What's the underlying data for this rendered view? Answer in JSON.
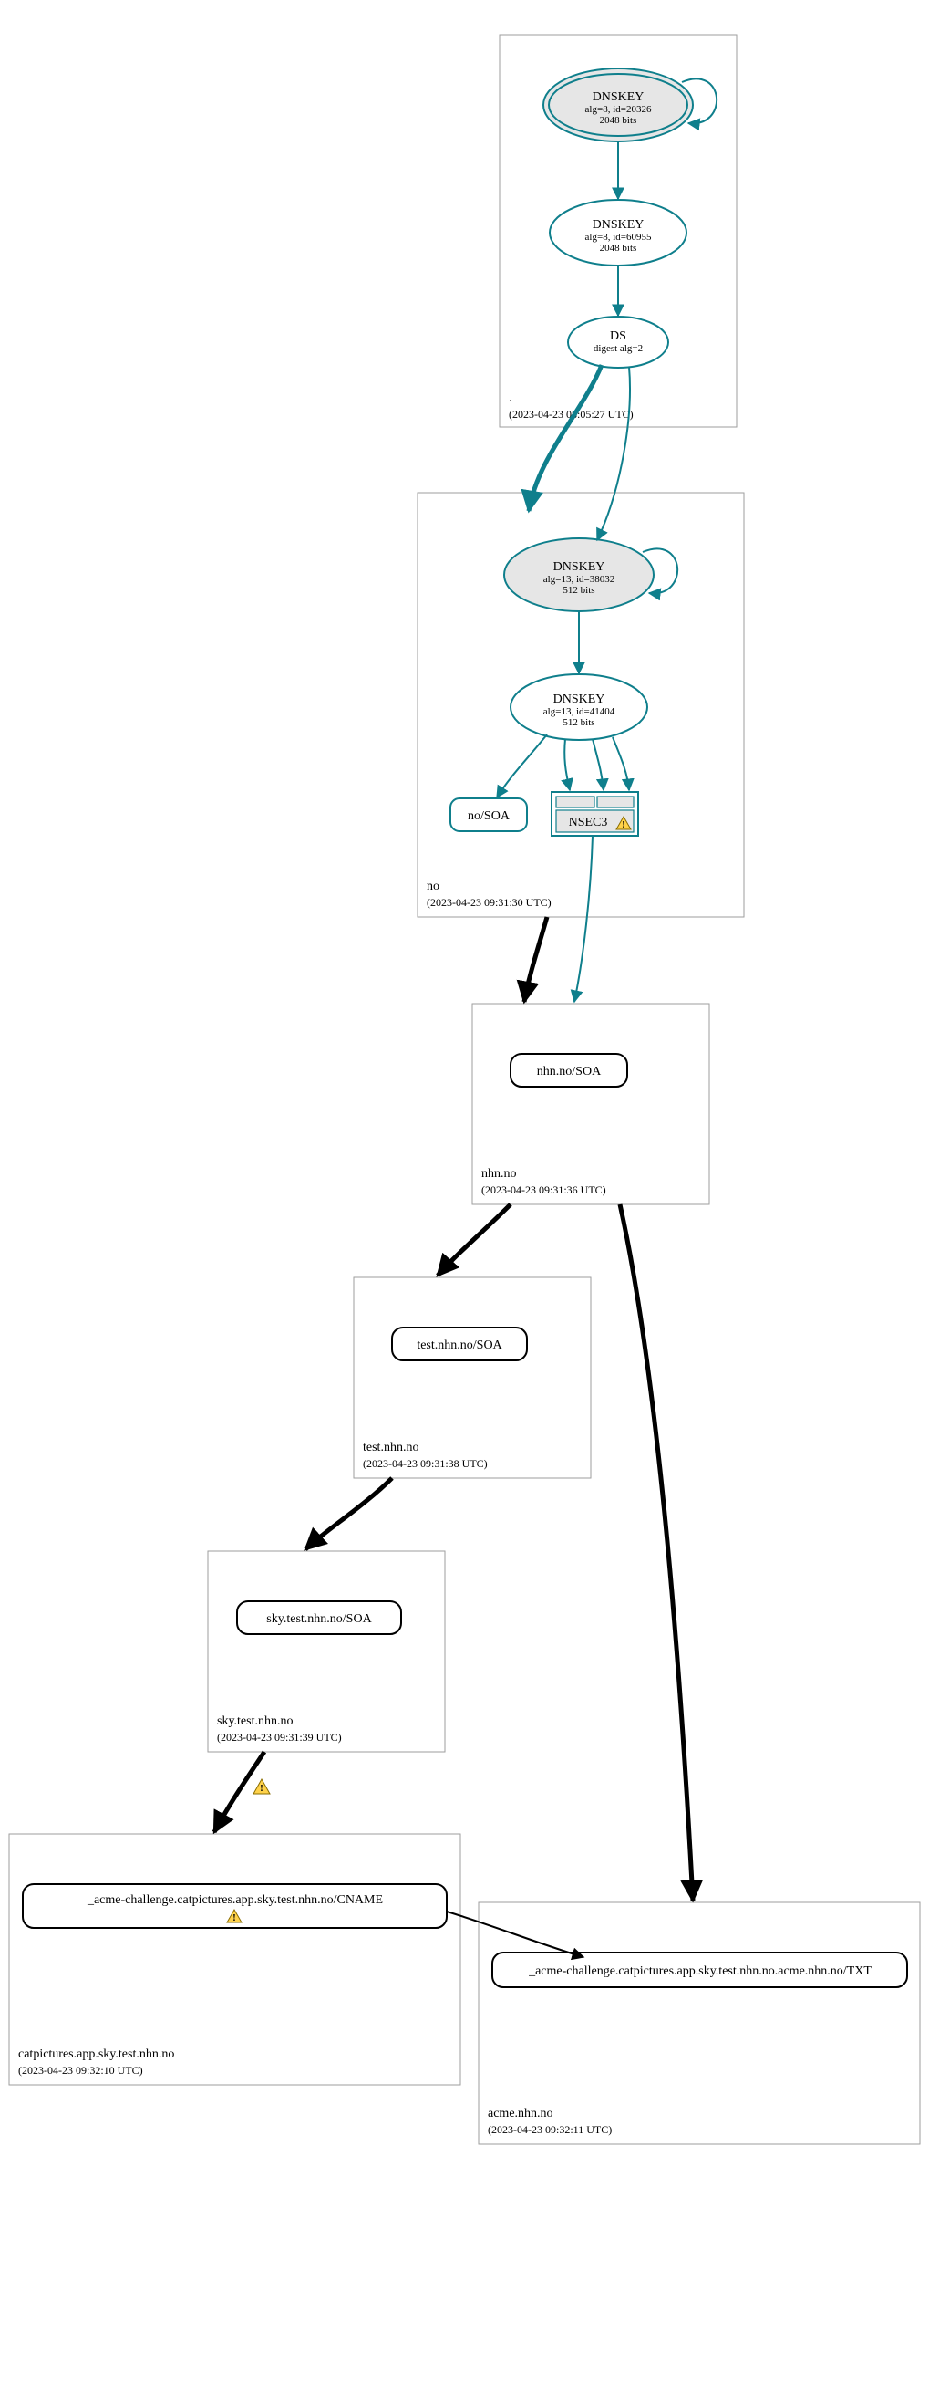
{
  "zones": {
    "root": {
      "title": ".",
      "ts": "(2023-04-23 08:05:27 UTC)"
    },
    "no": {
      "title": "no",
      "ts": "(2023-04-23 09:31:30 UTC)"
    },
    "nhn": {
      "title": "nhn.no",
      "ts": "(2023-04-23 09:31:36 UTC)"
    },
    "test": {
      "title": "test.nhn.no",
      "ts": "(2023-04-23 09:31:38 UTC)"
    },
    "sky": {
      "title": "sky.test.nhn.no",
      "ts": "(2023-04-23 09:31:39 UTC)"
    },
    "cat": {
      "title": "catpictures.app.sky.test.nhn.no",
      "ts": "(2023-04-23 09:32:10 UTC)"
    },
    "acme": {
      "title": "acme.nhn.no",
      "ts": "(2023-04-23 09:32:11 UTC)"
    }
  },
  "nodes": {
    "root_ksk": {
      "t": "DNSKEY",
      "s1": "alg=8, id=20326",
      "s2": "2048 bits"
    },
    "root_zsk": {
      "t": "DNSKEY",
      "s1": "alg=8, id=60955",
      "s2": "2048 bits"
    },
    "root_ds": {
      "t": "DS",
      "s1": "digest alg=2"
    },
    "no_ksk": {
      "t": "DNSKEY",
      "s1": "alg=13, id=38032",
      "s2": "512 bits"
    },
    "no_zsk": {
      "t": "DNSKEY",
      "s1": "alg=13, id=41404",
      "s2": "512 bits"
    },
    "no_soa": {
      "t": "no/SOA"
    },
    "no_nsec3": {
      "t": "NSEC3"
    },
    "nhn_soa": {
      "t": "nhn.no/SOA"
    },
    "test_soa": {
      "t": "test.nhn.no/SOA"
    },
    "sky_soa": {
      "t": "sky.test.nhn.no/SOA"
    },
    "cat_cname": {
      "t": "_acme-challenge.catpictures.app.sky.test.nhn.no/CNAME"
    },
    "acme_txt": {
      "t": "_acme-challenge.catpictures.app.sky.test.nhn.no.acme.nhn.no/TXT"
    }
  }
}
